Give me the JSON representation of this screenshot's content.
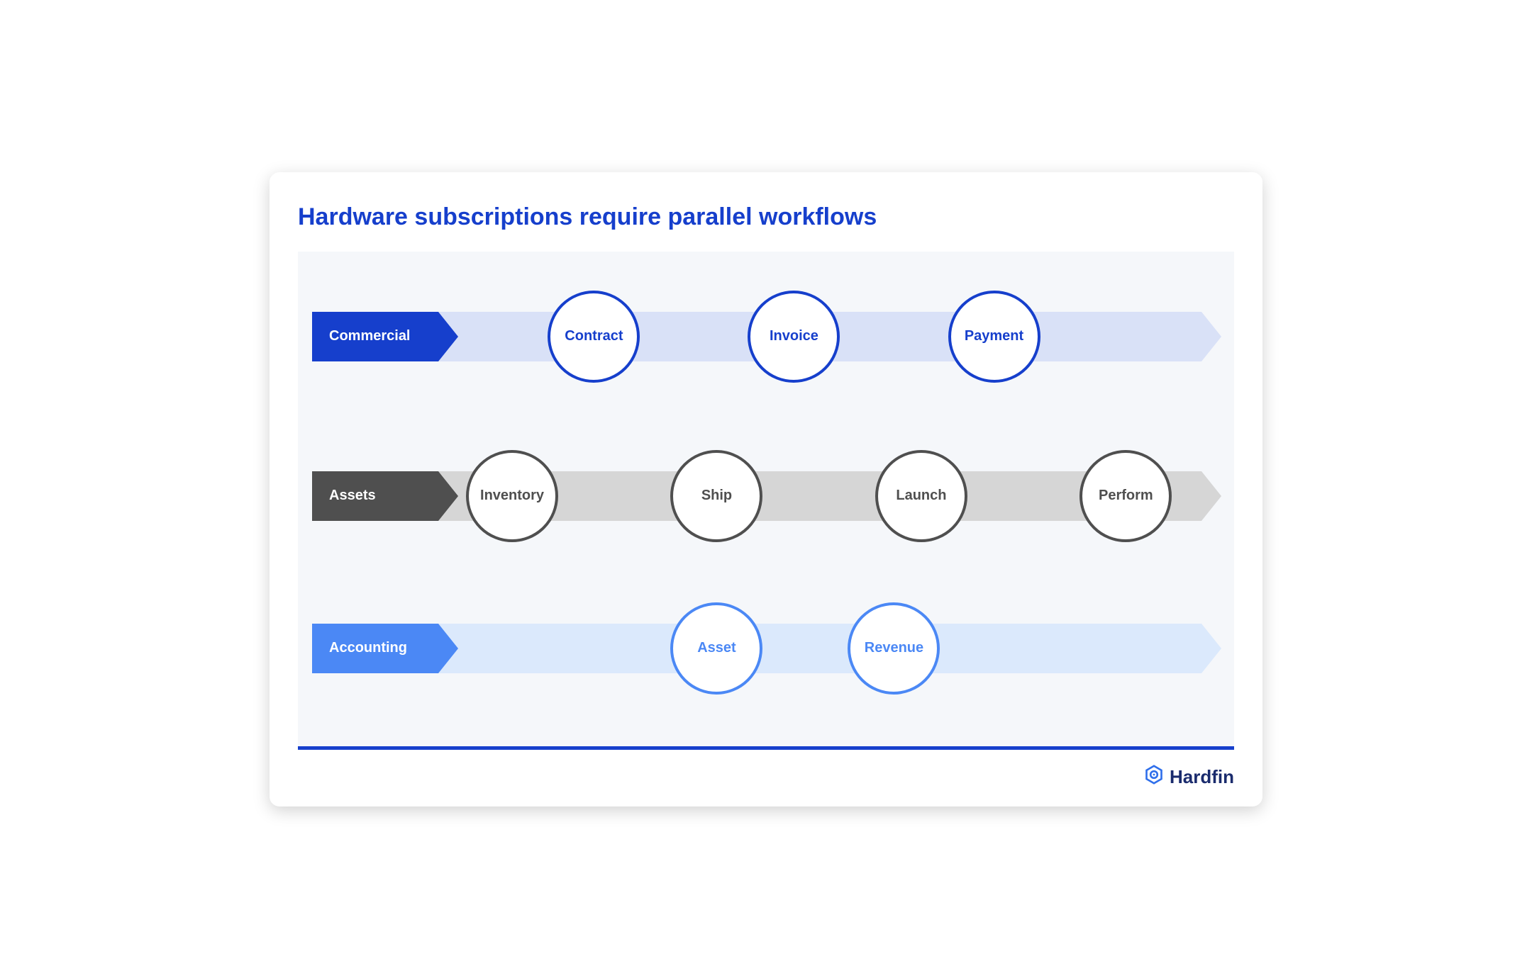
{
  "title": "Hardware subscriptions require parallel workflows",
  "lanes": {
    "commercial": {
      "label": "Commercial",
      "nodes": [
        "Contract",
        "Invoice",
        "Payment"
      ]
    },
    "assets": {
      "label": "Assets",
      "nodes": [
        "Inventory",
        "Ship",
        "Launch",
        "Perform"
      ]
    },
    "accounting": {
      "label": "Accounting",
      "nodes": [
        "Asset",
        "Revenue"
      ]
    }
  },
  "brand": {
    "name": "Hardfin"
  },
  "colors": {
    "primary_blue": "#163FCC",
    "light_blue_track": "#D9E1F7",
    "accent_blue": "#4B88F5",
    "light_blue_track2": "#DBE9FC",
    "grey_dark": "#4F4F4F",
    "grey_track": "#D6D6D6",
    "panel_bg": "#F5F7FA"
  }
}
